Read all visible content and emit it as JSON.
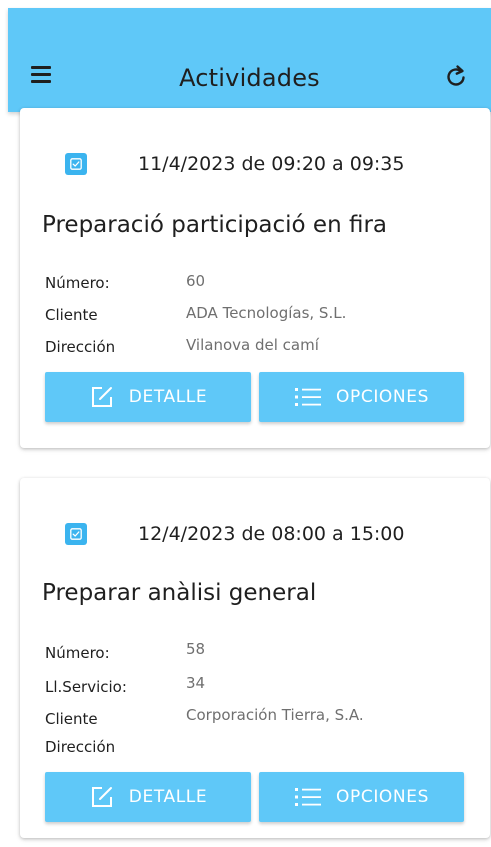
{
  "header": {
    "title": "Actividades",
    "menu_icon": "menu-icon",
    "refresh_icon": "refresh-icon"
  },
  "activities": [
    {
      "date_line": "11/4/2023 de 09:20 a 09:35",
      "title": "Preparació participació en fira",
      "fields": [
        {
          "label": "Número:",
          "value": "60"
        },
        {
          "label": "Cliente",
          "value": "ADA Tecnologías, S.L."
        },
        {
          "label": "Dirección",
          "value": "Vilanova del camí"
        }
      ],
      "detail_label": "DETALLE",
      "options_label": "OPCIONES"
    },
    {
      "date_line": "12/4/2023 de 08:00 a 15:00",
      "title": "Preparar anàlisi general",
      "fields": [
        {
          "label": "Número:",
          "value": "58"
        },
        {
          "label": "Ll.Servicio:",
          "value": "34"
        },
        {
          "label": "Cliente",
          "value": "Corporación Tierra, S.A."
        },
        {
          "label": "Dirección",
          "value": ""
        }
      ],
      "detail_label": "DETALLE",
      "options_label": "OPCIONES"
    }
  ],
  "colors": {
    "app_bar": "#5fc8f8",
    "button": "#5fc8f8",
    "checkbox": "#3bb4ef",
    "value_text": "#6f6f6f"
  }
}
